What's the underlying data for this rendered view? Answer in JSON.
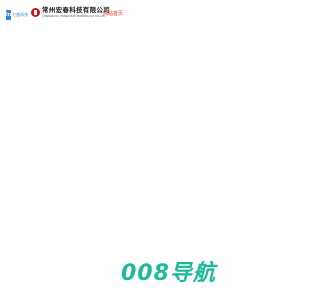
{
  "header": {
    "partner_logo": {
      "badge": "in",
      "name": "七曲科技"
    },
    "company_logo": {
      "name_cn": "常州宏春科技有限公司",
      "name_en": "CHANGZHOU HONGCHUN TECHNOLOGY CO.,LTD"
    },
    "home_link": "网站首页"
  },
  "main": {
    "brand_title": "008导航"
  },
  "colors": {
    "accent_blue": "#2c84e3",
    "seal_red": "#c8161d",
    "link_red": "#e0302a",
    "brand_teal": "#1fba9a"
  }
}
